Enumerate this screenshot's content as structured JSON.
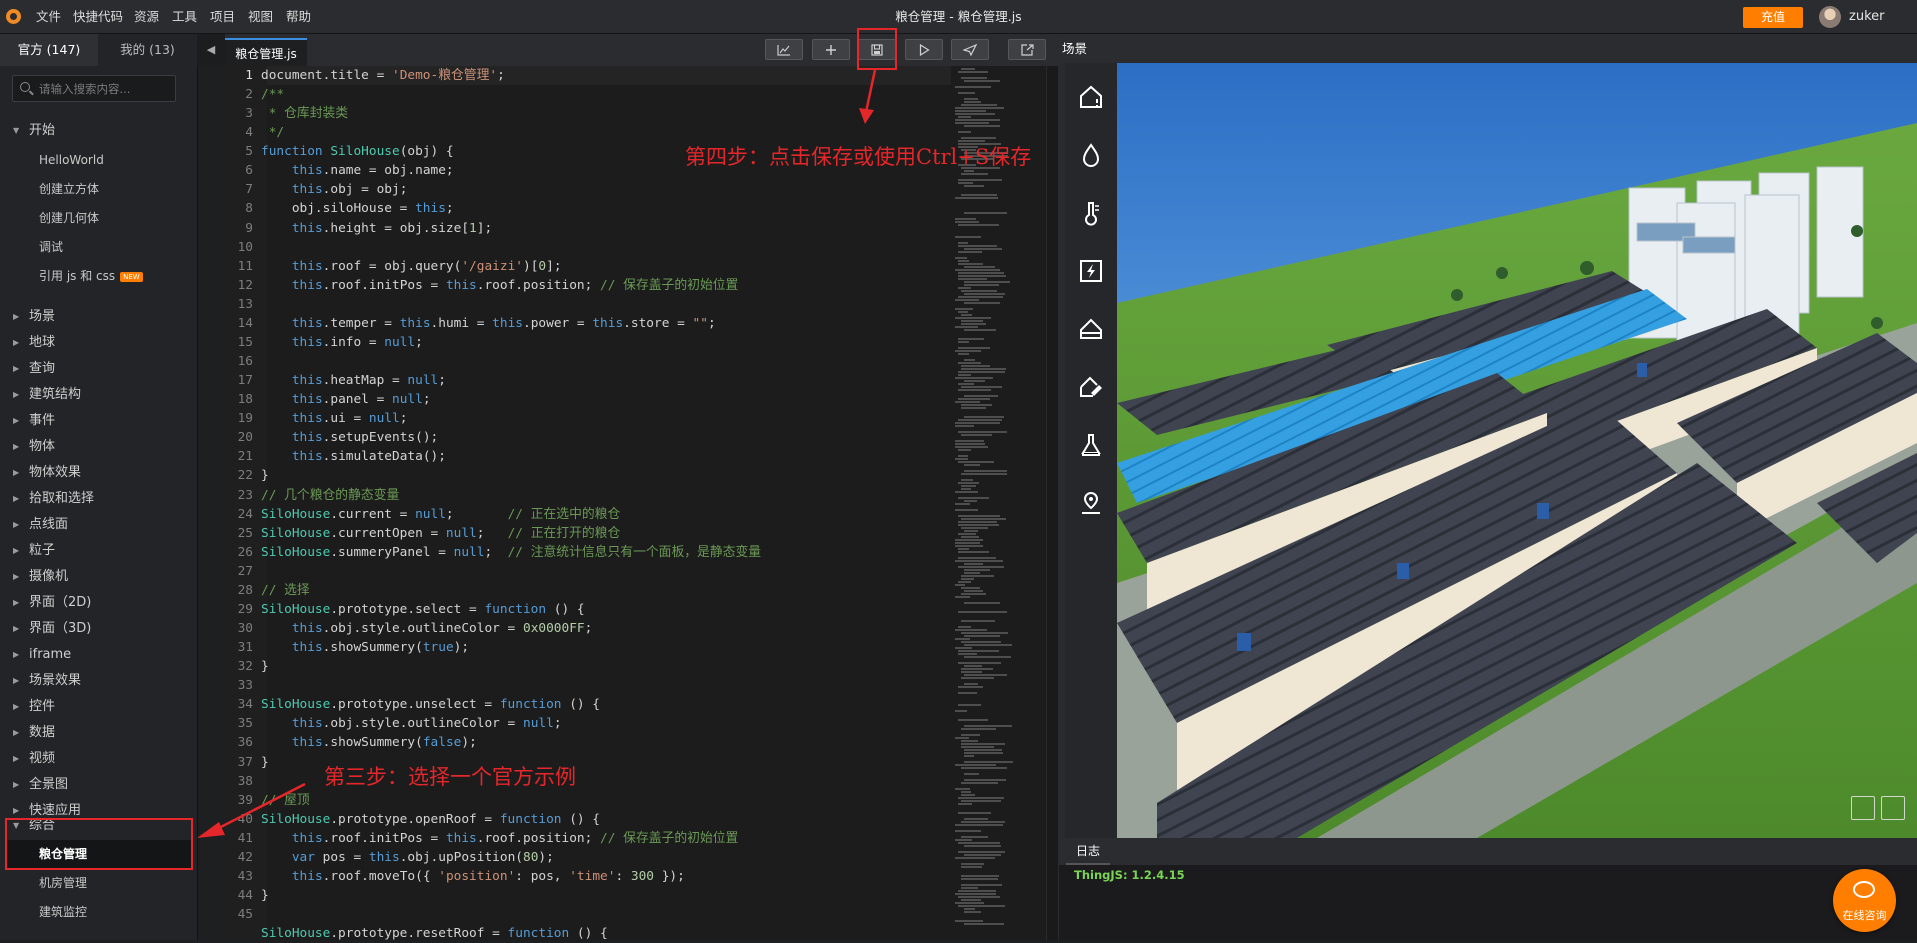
{
  "menubar": {
    "items": [
      "文件",
      "快捷代码",
      "资源",
      "工具",
      "项目",
      "视图",
      "帮助"
    ],
    "window_title": "粮仓管理 -  粮仓管理.js",
    "recharge_label": "充值",
    "username": "zuker"
  },
  "sidebar": {
    "tabs": [
      {
        "label": "官方 (147)"
      },
      {
        "label": "我的 (13)"
      }
    ],
    "search_placeholder": "请输入搜索内容...",
    "start_label": "开始",
    "start_children": [
      "HelloWorld",
      "创建立方体",
      "创建几何体",
      "调试",
      "引用 js 和 css"
    ],
    "new_badge": "NEW",
    "categories": [
      "场景",
      "地球",
      "查询",
      "建筑结构",
      "事件",
      "物体",
      "物体效果",
      "拾取和选择",
      "点线面",
      "粒子",
      "摄像机",
      "界面（2D)",
      "界面（3D)",
      "iframe",
      "场景效果",
      "控件",
      "数据",
      "视频",
      "全景图",
      "快速应用"
    ],
    "composite_label": "综合",
    "composite_children": [
      "粮仓管理",
      "机房管理",
      "建筑监控"
    ]
  },
  "editor": {
    "file_tab": "粮仓管理.js",
    "line_numbers": [
      "1",
      "2",
      "3",
      "4",
      "5",
      "6",
      "7",
      "8",
      "9",
      "10",
      "11",
      "12",
      "13",
      "14",
      "15",
      "16",
      "17",
      "18",
      "19",
      "20",
      "21",
      "22",
      "23",
      "24",
      "25",
      "26",
      "27",
      "28",
      "29",
      "30",
      "31",
      "32",
      "33",
      "34",
      "35",
      "36",
      "37",
      "38",
      "39",
      "40",
      "41",
      "42",
      "43",
      "44",
      "45"
    ],
    "code": [
      [
        [
          "document.title = ",
          "p"
        ],
        [
          "'Demo-粮仓管理'",
          "s"
        ],
        [
          ";",
          "p"
        ]
      ],
      [
        [
          "/**",
          "c"
        ]
      ],
      [
        [
          " * 仓库封装类",
          "c"
        ]
      ],
      [
        [
          " */",
          "c"
        ]
      ],
      [
        [
          "function ",
          "k"
        ],
        [
          "SiloHouse",
          "f"
        ],
        [
          "(obj) {",
          "p"
        ]
      ],
      [
        [
          "    ",
          "p"
        ],
        [
          "this",
          "k"
        ],
        [
          ".name = obj.name;",
          "p"
        ]
      ],
      [
        [
          "    ",
          "p"
        ],
        [
          "this",
          "k"
        ],
        [
          ".obj = obj;",
          "p"
        ]
      ],
      [
        [
          "    obj.siloHouse = ",
          "p"
        ],
        [
          "this",
          "k"
        ],
        [
          ";",
          "p"
        ]
      ],
      [
        [
          "    ",
          "p"
        ],
        [
          "this",
          "k"
        ],
        [
          ".height = obj.size[",
          "p"
        ],
        [
          "1",
          "n"
        ],
        [
          "];",
          "p"
        ]
      ],
      [
        [
          "",
          "p"
        ]
      ],
      [
        [
          "    ",
          "p"
        ],
        [
          "this",
          "k"
        ],
        [
          ".roof = obj.query(",
          "p"
        ],
        [
          "'/gaizi'",
          "s"
        ],
        [
          ")[",
          "p"
        ],
        [
          "0",
          "n"
        ],
        [
          "];",
          "p"
        ]
      ],
      [
        [
          "    ",
          "p"
        ],
        [
          "this",
          "k"
        ],
        [
          ".roof.initPos = ",
          "p"
        ],
        [
          "this",
          "k"
        ],
        [
          ".roof.position; ",
          "p"
        ],
        [
          "// 保存盖子的初始位置",
          "c"
        ]
      ],
      [
        [
          "",
          "p"
        ]
      ],
      [
        [
          "    ",
          "p"
        ],
        [
          "this",
          "k"
        ],
        [
          ".temper = ",
          "p"
        ],
        [
          "this",
          "k"
        ],
        [
          ".humi = ",
          "p"
        ],
        [
          "this",
          "k"
        ],
        [
          ".power = ",
          "p"
        ],
        [
          "this",
          "k"
        ],
        [
          ".store = ",
          "p"
        ],
        [
          "\"\"",
          "s"
        ],
        [
          ";",
          "p"
        ]
      ],
      [
        [
          "    ",
          "p"
        ],
        [
          "this",
          "k"
        ],
        [
          ".info = ",
          "p"
        ],
        [
          "null",
          "k"
        ],
        [
          ";",
          "p"
        ]
      ],
      [
        [
          "",
          "p"
        ]
      ],
      [
        [
          "    ",
          "p"
        ],
        [
          "this",
          "k"
        ],
        [
          ".heatMap = ",
          "p"
        ],
        [
          "null",
          "k"
        ],
        [
          ";",
          "p"
        ]
      ],
      [
        [
          "    ",
          "p"
        ],
        [
          "this",
          "k"
        ],
        [
          ".panel = ",
          "p"
        ],
        [
          "null",
          "k"
        ],
        [
          ";",
          "p"
        ]
      ],
      [
        [
          "    ",
          "p"
        ],
        [
          "this",
          "k"
        ],
        [
          ".ui = ",
          "p"
        ],
        [
          "null",
          "k"
        ],
        [
          ";",
          "p"
        ]
      ],
      [
        [
          "    ",
          "p"
        ],
        [
          "this",
          "k"
        ],
        [
          ".setupEvents();",
          "p"
        ]
      ],
      [
        [
          "    ",
          "p"
        ],
        [
          "this",
          "k"
        ],
        [
          ".simulateData();",
          "p"
        ]
      ],
      [
        [
          "}",
          "p"
        ]
      ],
      [
        [
          "// 几个粮仓的静态变量",
          "c"
        ]
      ],
      [
        [
          "SiloHouse",
          "f"
        ],
        [
          ".current = ",
          "p"
        ],
        [
          "null",
          "k"
        ],
        [
          ";       ",
          "p"
        ],
        [
          "// 正在选中的粮仓",
          "c"
        ]
      ],
      [
        [
          "SiloHouse",
          "f"
        ],
        [
          ".currentOpen = ",
          "p"
        ],
        [
          "null",
          "k"
        ],
        [
          ";   ",
          "p"
        ],
        [
          "// 正在打开的粮仓",
          "c"
        ]
      ],
      [
        [
          "SiloHouse",
          "f"
        ],
        [
          ".summeryPanel = ",
          "p"
        ],
        [
          "null",
          "k"
        ],
        [
          ";  ",
          "p"
        ],
        [
          "// 注意统计信息只有一个面板，是静态变量",
          "c"
        ]
      ],
      [
        [
          "",
          "p"
        ]
      ],
      [
        [
          "// 选择",
          "c"
        ]
      ],
      [
        [
          "SiloHouse",
          "f"
        ],
        [
          ".prototype.select = ",
          "p"
        ],
        [
          "function",
          "k"
        ],
        [
          " () {",
          "p"
        ]
      ],
      [
        [
          "    ",
          "p"
        ],
        [
          "this",
          "k"
        ],
        [
          ".obj.style.outlineColor = ",
          "p"
        ],
        [
          "0x0000FF",
          "n"
        ],
        [
          ";",
          "p"
        ]
      ],
      [
        [
          "    ",
          "p"
        ],
        [
          "this",
          "k"
        ],
        [
          ".showSummery(",
          "p"
        ],
        [
          "true",
          "k"
        ],
        [
          ");",
          "p"
        ]
      ],
      [
        [
          "}",
          "p"
        ]
      ],
      [
        [
          "",
          "p"
        ]
      ],
      [
        [
          "SiloHouse",
          "f"
        ],
        [
          ".prototype.unselect = ",
          "p"
        ],
        [
          "function",
          "k"
        ],
        [
          " () {",
          "p"
        ]
      ],
      [
        [
          "    ",
          "p"
        ],
        [
          "this",
          "k"
        ],
        [
          ".obj.style.outlineColor = ",
          "p"
        ],
        [
          "null",
          "k"
        ],
        [
          ";",
          "p"
        ]
      ],
      [
        [
          "    ",
          "p"
        ],
        [
          "this",
          "k"
        ],
        [
          ".showSummery(",
          "p"
        ],
        [
          "false",
          "k"
        ],
        [
          ");",
          "p"
        ]
      ],
      [
        [
          "}",
          "p"
        ]
      ],
      [
        [
          "",
          "p"
        ]
      ],
      [
        [
          "// 屋顶",
          "c"
        ]
      ],
      [
        [
          "SiloHouse",
          "f"
        ],
        [
          ".prototype.openRoof = ",
          "p"
        ],
        [
          "function",
          "k"
        ],
        [
          " () {",
          "p"
        ]
      ],
      [
        [
          "    ",
          "p"
        ],
        [
          "this",
          "k"
        ],
        [
          ".roof.initPos = ",
          "p"
        ],
        [
          "this",
          "k"
        ],
        [
          ".roof.position; ",
          "p"
        ],
        [
          "// 保存盖子的初始位置",
          "c"
        ]
      ],
      [
        [
          "    ",
          "p"
        ],
        [
          "var",
          "k"
        ],
        [
          " pos = ",
          "p"
        ],
        [
          "this",
          "k"
        ],
        [
          ".obj.upPosition(",
          "p"
        ],
        [
          "80",
          "n"
        ],
        [
          ");",
          "p"
        ]
      ],
      [
        [
          "    ",
          "p"
        ],
        [
          "this",
          "k"
        ],
        [
          ".roof.moveTo({ ",
          "p"
        ],
        [
          "'position'",
          "s"
        ],
        [
          ": pos, ",
          "p"
        ],
        [
          "'time'",
          "s"
        ],
        [
          ": ",
          "p"
        ],
        [
          "300",
          "n"
        ],
        [
          " });",
          "p"
        ]
      ],
      [
        [
          "}",
          "p"
        ]
      ],
      [
        [
          "",
          "p"
        ]
      ],
      [
        [
          "SiloHouse",
          "f"
        ],
        [
          ".prototype.resetRoof = ",
          "p"
        ],
        [
          "function",
          "k"
        ],
        [
          " () {",
          "p"
        ]
      ]
    ]
  },
  "scene": {
    "tab_label": "场景",
    "tools": [
      "warehouse-alert-icon",
      "humidity-drop-icon",
      "thermometer-icon",
      "power-bolt-icon",
      "storage-house-icon",
      "warehouse-edit-icon",
      "flask-icon",
      "location-pin-icon"
    ]
  },
  "log": {
    "tab_label": "日志",
    "line": "ThingJS: 1.2.4.15"
  },
  "chat": {
    "label": "在线咨询"
  },
  "annotations": {
    "step3": "第三步：选择一个官方示例",
    "step4": "第四步：点击保存或使用Ctrl+S保存"
  },
  "colors": {
    "accent": "#ff7e00",
    "annotation": "#e5262a",
    "keyword": "#569cd6",
    "string": "#ce9178",
    "comment": "#6a9955",
    "function_name": "#4ec9b0",
    "number": "#b5cea8",
    "log_text": "#7ad455"
  }
}
